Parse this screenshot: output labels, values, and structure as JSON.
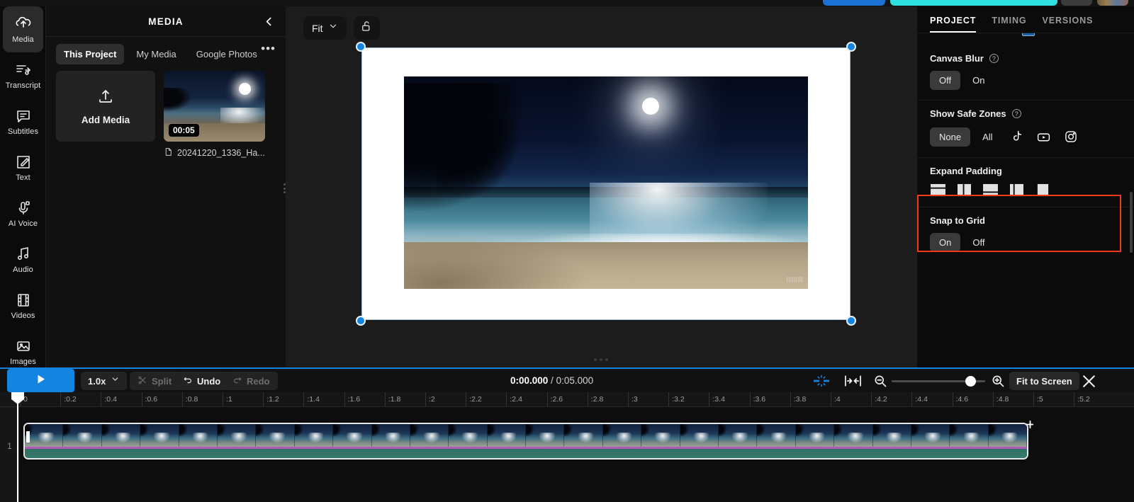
{
  "rail": {
    "items": [
      {
        "label": "Media",
        "icon": "media-upload-icon",
        "active": true
      },
      {
        "label": "Transcript",
        "icon": "transcript-icon",
        "active": false
      },
      {
        "label": "Subtitles",
        "icon": "subtitles-icon",
        "active": false
      },
      {
        "label": "Text",
        "icon": "text-edit-icon",
        "active": false
      },
      {
        "label": "AI Voice",
        "icon": "microphone-icon",
        "active": false
      },
      {
        "label": "Audio",
        "icon": "music-note-icon",
        "active": false
      },
      {
        "label": "Videos",
        "icon": "film-strip-icon",
        "active": false
      },
      {
        "label": "Images",
        "icon": "image-icon",
        "active": false
      }
    ]
  },
  "media_panel": {
    "title": "MEDIA",
    "collapse_icon": "chevron-left-icon",
    "more_label": "•••",
    "tabs": [
      {
        "label": "This Project",
        "active": true
      },
      {
        "label": "My Media",
        "active": false
      },
      {
        "label": "Google Photos",
        "active": false
      }
    ],
    "add_media_label": "Add Media",
    "asset": {
      "duration": "00:05",
      "filename": "20241220_1336_Ha..."
    }
  },
  "stage": {
    "fit_label": "Fit",
    "fit_caret": "chevron-down-icon",
    "lock_icon": "unlock-icon",
    "watermark": "|||||||||"
  },
  "props": {
    "tabs": [
      {
        "label": "PROJECT",
        "active": true
      },
      {
        "label": "TIMING",
        "active": false
      },
      {
        "label": "VERSIONS",
        "active": false
      }
    ],
    "canvas_blur": {
      "label": "Canvas Blur",
      "help": "?",
      "options": [
        {
          "label": "Off",
          "active": true
        },
        {
          "label": "On",
          "active": false
        }
      ]
    },
    "safe_zones": {
      "label": "Show Safe Zones",
      "help": "?",
      "options": [
        {
          "label": "None",
          "active": true,
          "type": "text"
        },
        {
          "label": "All",
          "active": false,
          "type": "text"
        },
        {
          "label": "tiktok-icon",
          "active": false,
          "type": "icon"
        },
        {
          "label": "youtube-icon",
          "active": false,
          "type": "icon"
        },
        {
          "label": "instagram-icon",
          "active": false,
          "type": "icon"
        }
      ]
    },
    "expand_padding": {
      "label": "Expand Padding",
      "highlight_color": "#ef3b19",
      "options": [
        "padding-top-split-icon",
        "padding-left-split-icon",
        "padding-bottom-split-icon",
        "padding-right-split-icon",
        "padding-full-icon"
      ]
    },
    "snap_to_grid": {
      "label": "Snap to Grid",
      "options": [
        {
          "label": "On",
          "active": true
        },
        {
          "label": "Off",
          "active": false
        }
      ]
    }
  },
  "controls": {
    "play_icon": "play-icon",
    "speed": "1.0x",
    "speed_caret": "chevron-down-icon",
    "split_label": "Split",
    "split_icon": "scissors-icon",
    "undo_label": "Undo",
    "undo_icon": "undo-arrow-icon",
    "redo_label": "Redo",
    "redo_icon": "redo-arrow-icon",
    "current_time": "0:00.000",
    "time_separator": " / ",
    "total_time": "0:05.000",
    "snap_icon": "snap-magnet-icon",
    "fit_clips_icon": "fit-clips-icon",
    "zoom_out_icon": "zoom-out-icon",
    "zoom_in_icon": "zoom-in-icon",
    "fit_to_screen_label": "Fit to Screen",
    "close_icon": "close-icon",
    "accent_color": "#1385e0"
  },
  "timeline": {
    "track_label": "1",
    "ruler_ticks": [
      "0",
      ":0.2",
      ":0.4",
      ":0.6",
      ":0.8",
      ":1",
      ":1.2",
      ":1.4",
      ":1.6",
      ":1.8",
      ":2",
      ":2.2",
      ":2.4",
      ":2.6",
      ":2.8",
      ":3",
      ":3.2",
      ":3.4",
      ":3.6",
      ":3.8",
      ":4",
      ":4.2",
      ":4.4",
      ":4.6",
      ":4.8",
      ":5",
      ":5.2"
    ]
  }
}
